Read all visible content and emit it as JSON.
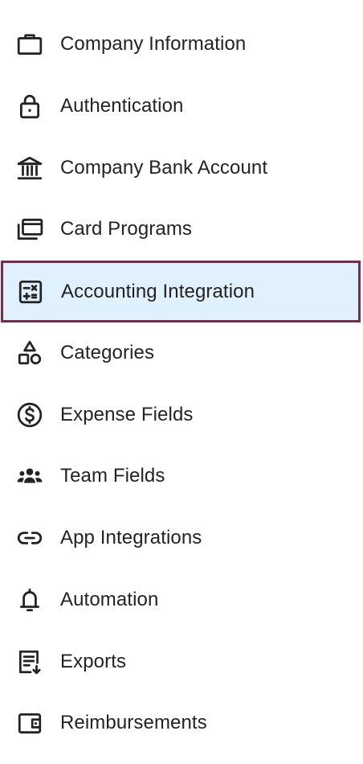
{
  "sidebar": {
    "active_index": 4,
    "accent_border_color": "#7a2a4c",
    "active_background_color": "#e0f0fd",
    "items": [
      {
        "label": "Company Information",
        "icon": "briefcase-icon"
      },
      {
        "label": "Authentication",
        "icon": "lock-icon"
      },
      {
        "label": "Company Bank Account",
        "icon": "bank-icon"
      },
      {
        "label": "Card Programs",
        "icon": "cards-icon"
      },
      {
        "label": "Accounting Integration",
        "icon": "calculator-icon"
      },
      {
        "label": "Categories",
        "icon": "shapes-icon"
      },
      {
        "label": "Expense Fields",
        "icon": "dollar-circle-icon"
      },
      {
        "label": "Team Fields",
        "icon": "team-icon"
      },
      {
        "label": "App Integrations",
        "icon": "link-icon"
      },
      {
        "label": "Automation",
        "icon": "bell-icon"
      },
      {
        "label": "Exports",
        "icon": "export-document-icon"
      },
      {
        "label": "Reimbursements",
        "icon": "wallet-icon"
      }
    ]
  }
}
